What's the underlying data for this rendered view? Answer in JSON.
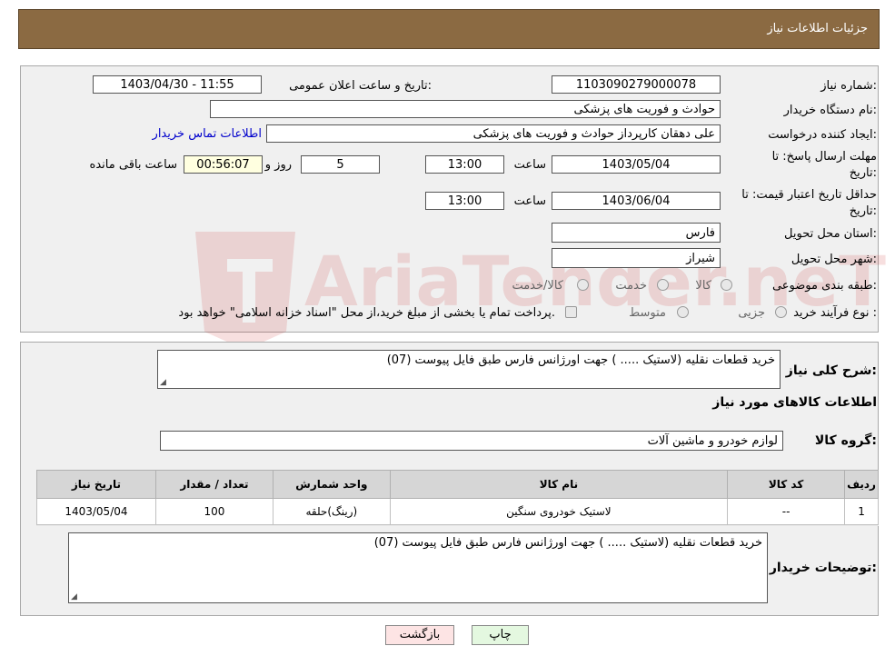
{
  "header": {
    "title": "جزئیات اطلاعات نیاز"
  },
  "form": {
    "need_number_label": "شماره نیاز:",
    "need_number": "1103090279000078",
    "announce_label": "تاریخ و ساعت اعلان عمومی:",
    "announce_value": "1403/04/30 - 11:55",
    "buyer_org_label": "نام دستگاه خریدار:",
    "buyer_org": "حوادث و فوریت های پزشکی",
    "creator_label": "ایجاد کننده درخواست:",
    "creator": "علی دهقان کارپرداز حوادث و فوریت های پزشکی",
    "contact_link": "اطلاعات تماس خریدار",
    "deadline_label_1": "مهلت ارسال پاسخ: تا",
    "deadline_label_2": "تاریخ:",
    "deadline_date": "1403/05/04",
    "time_label": "ساعت",
    "deadline_time": "13:00",
    "days_value": "5",
    "days_label": "روز و",
    "remaining_time": "00:56:07",
    "remaining_label": "ساعت باقی مانده",
    "validity_label_1": "حداقل تاریخ اعتبار قیمت: تا",
    "validity_label_2": "تاریخ:",
    "validity_date": "1403/06/04",
    "validity_time": "13:00",
    "province_label": "استان محل تحویل:",
    "province": "فارس",
    "city_label": "شهر محل تحویل:",
    "city": "شیراز",
    "category_label": "طبقه بندی موضوعی:",
    "category_options": [
      "کالا",
      "خدمت",
      "کالا/خدمت"
    ],
    "process_label": "نوع فرآیند خرید :",
    "process_options": [
      "جزیی",
      "متوسط"
    ],
    "process_note": "پرداخت تمام یا بخشی از مبلغ خرید،از محل \"اسناد خزانه اسلامی\" خواهد بود."
  },
  "details": {
    "summary_label": "شرح کلی نیاز:",
    "summary": "خرید قطعات نقلیه (لاستیک ..... ) جهت اورژانس فارس طبق فایل پیوست (07)",
    "goods_info_title": "اطلاعات کالاهای مورد نیاز",
    "goods_group_label": "گروه کالا:",
    "goods_group": "لوازم خودرو و ماشین آلات",
    "table": {
      "headers": [
        "ردیف",
        "کد کالا",
        "نام کالا",
        "واحد شمارش",
        "تعداد / مقدار",
        "تاریخ نیاز"
      ],
      "rows": [
        [
          "1",
          "--",
          "لاستیک خودروی سنگین",
          "(رینگ)حلقه",
          "100",
          "1403/05/04"
        ]
      ]
    },
    "buyer_notes_label": "توضیحات خریدار:",
    "buyer_notes": "خرید قطعات نقلیه (لاستیک ..... ) جهت اورژانس فارس طبق فایل پیوست (07)"
  },
  "buttons": {
    "print": "چاپ",
    "back": "بازگشت"
  },
  "watermark": {
    "text": "AriaTender.neT"
  },
  "colors": {
    "header_bg": "#8b6a42",
    "link": "#0000cc",
    "back_btn_bg": "#fde4e4",
    "print_btn_bg": "#e4f8e0"
  }
}
